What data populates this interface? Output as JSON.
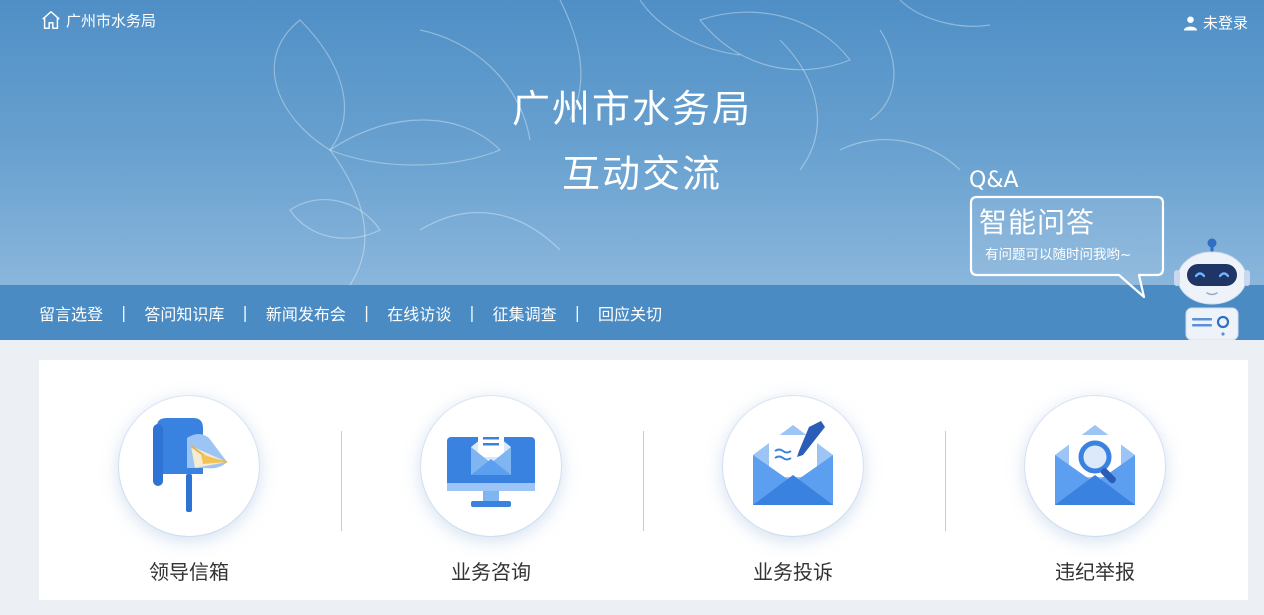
{
  "topbar": {
    "home_label": "广州市水务局",
    "user_label": "未登录"
  },
  "hero": {
    "title": "广州市水务局",
    "subtitle": "互动交流"
  },
  "nav": {
    "items": [
      {
        "label": "留言选登"
      },
      {
        "label": "答问知识库"
      },
      {
        "label": "新闻发布会"
      },
      {
        "label": "在线访谈"
      },
      {
        "label": "征集调查"
      },
      {
        "label": "回应关切"
      }
    ],
    "separator": "|"
  },
  "qa": {
    "label": "Q&A",
    "title": "智能问答",
    "desc": "有问题可以随时问我哟~"
  },
  "services": [
    {
      "label": "领导信箱",
      "icon": "mailbox-icon"
    },
    {
      "label": "业务咨询",
      "icon": "monitor-mail-icon"
    },
    {
      "label": "业务投诉",
      "icon": "envelope-pen-icon"
    },
    {
      "label": "违纪举报",
      "icon": "envelope-search-icon"
    }
  ],
  "colors": {
    "banner": "#5b98cb",
    "nav": "#4a8bc4",
    "icon_blue": "#3a82e0",
    "icon_light": "#7fb5f0"
  }
}
